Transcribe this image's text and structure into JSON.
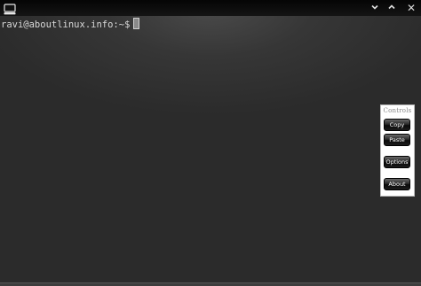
{
  "window": {
    "icon": "terminal-icon",
    "buttons": [
      {
        "name": "minimize",
        "icon": "chevron-down-icon"
      },
      {
        "name": "maximize",
        "icon": "chevron-up-icon"
      },
      {
        "name": "close",
        "glyph": "✕",
        "icon": "close-icon"
      }
    ]
  },
  "terminal": {
    "prompt": "ravi@aboutlinux.info:~$"
  },
  "controls": {
    "title": "Controls",
    "copy_label": "Copy",
    "paste_label": "Paste",
    "options_label": "Options",
    "about_label": "About"
  }
}
